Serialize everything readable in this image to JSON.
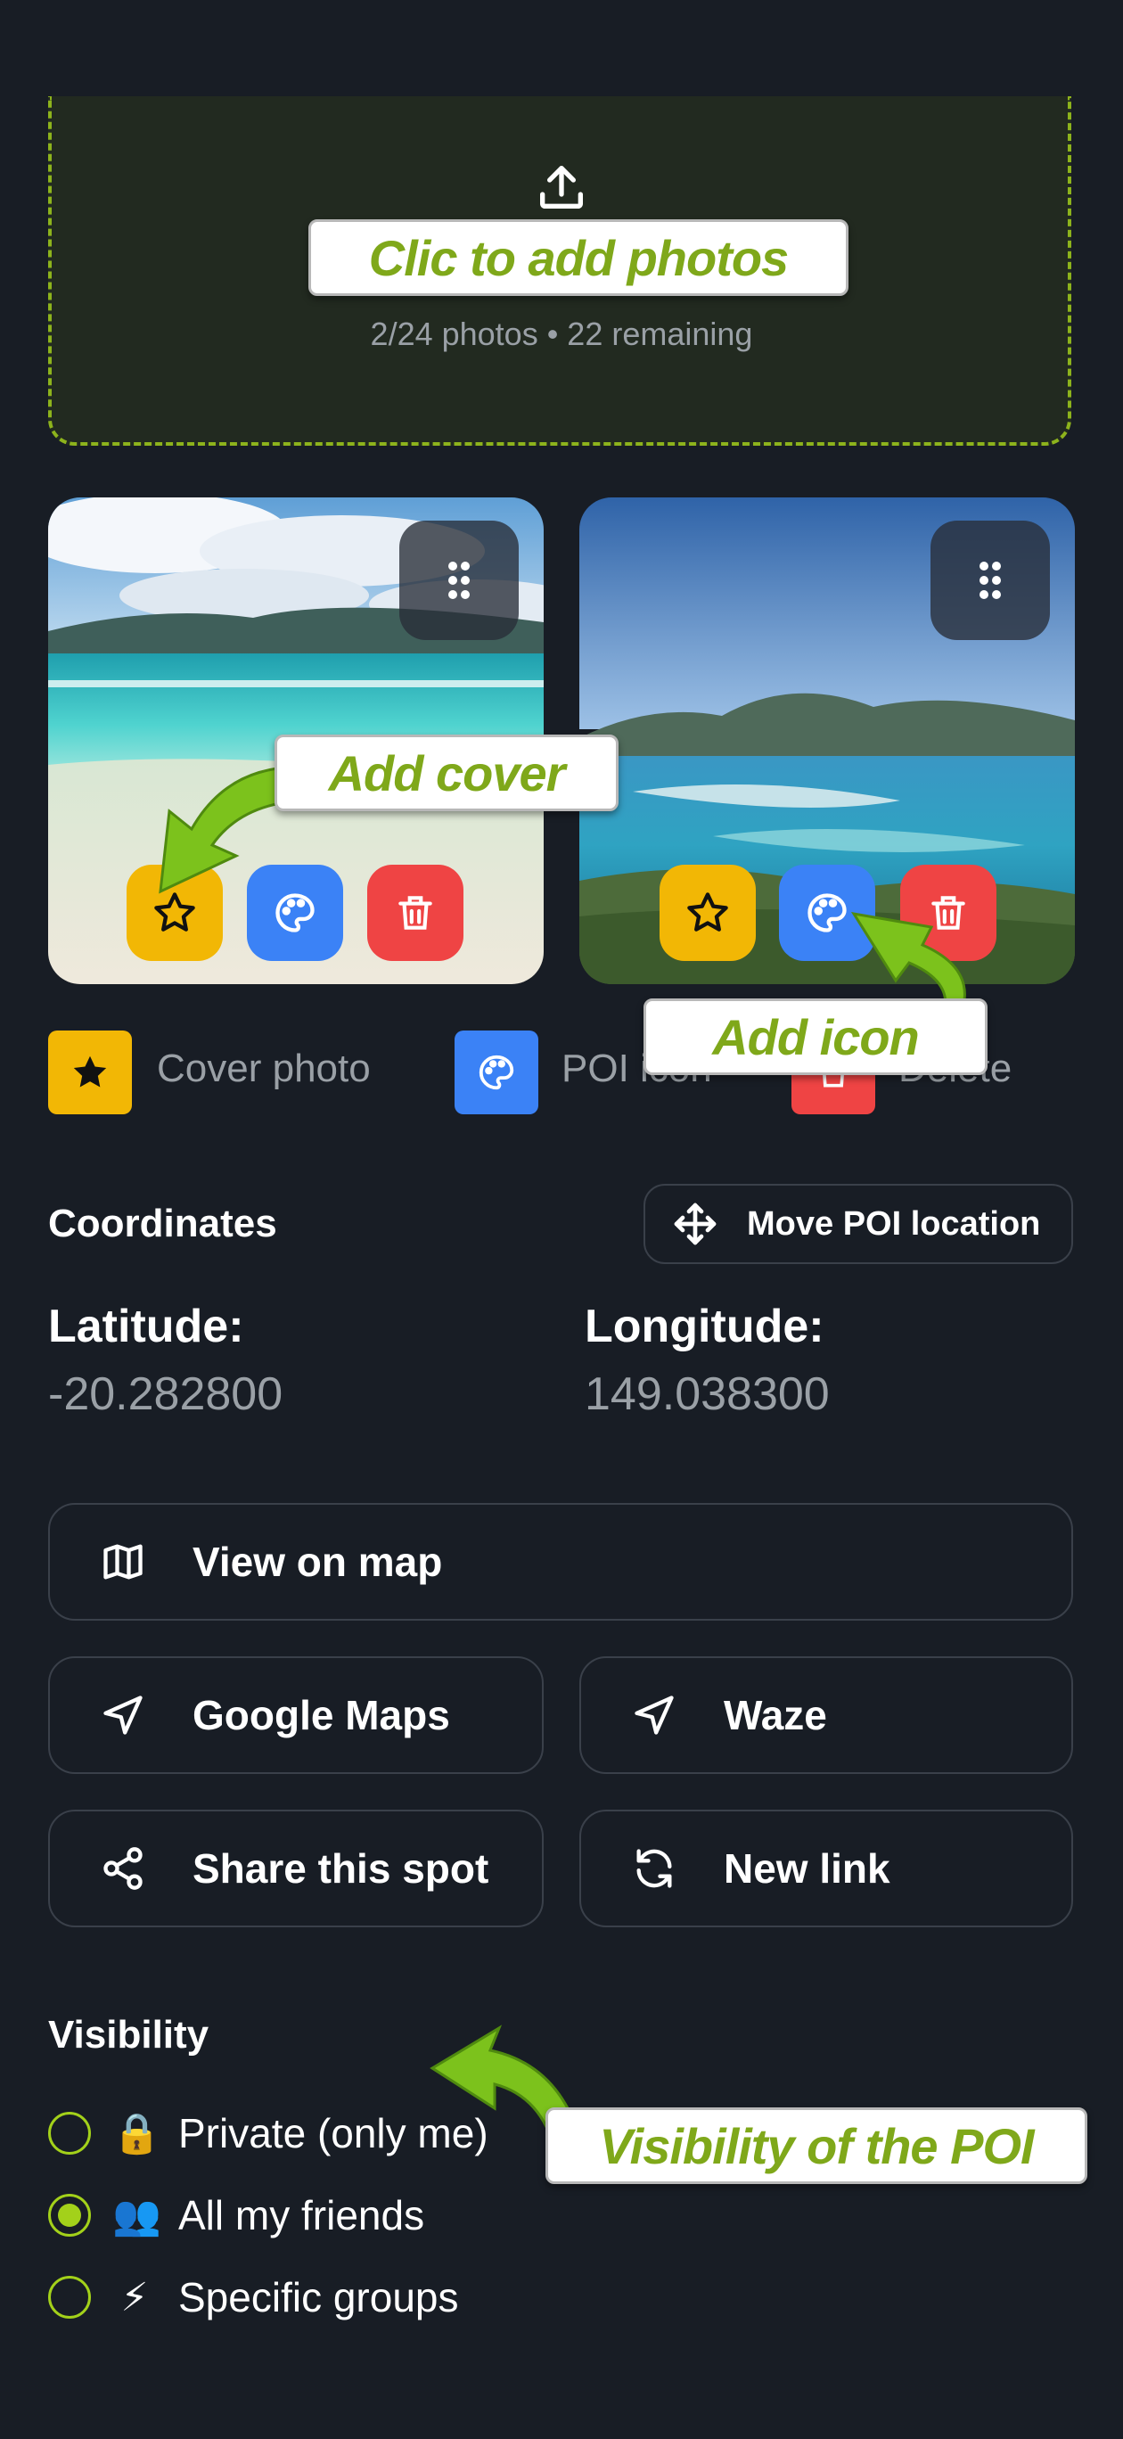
{
  "upload": {
    "callout": "Clic to add photos",
    "count_text": "2/24 photos • 22 remaining",
    "icon": "upload-icon"
  },
  "photos": [
    {
      "name": "beach-photo-1",
      "scene": "tropical-beach"
    },
    {
      "name": "beach-photo-2",
      "scene": "lagoon-view"
    }
  ],
  "callouts": {
    "add_cover": "Add cover",
    "add_icon": "Add icon",
    "visibility": "Visibility of the POI"
  },
  "legend": {
    "cover": "Cover photo",
    "poi_icon": "POI icon",
    "delete": "Delete"
  },
  "coordinates": {
    "title": "Coordinates",
    "move_button": "Move POI location",
    "latitude_label": "Latitude:",
    "latitude_value": "-20.282800",
    "longitude_label": "Longitude:",
    "longitude_value": "149.038300"
  },
  "actions": {
    "view_on_map": "View on map",
    "google_maps": "Google Maps",
    "waze": "Waze",
    "share": "Share this spot",
    "new_link": "New link"
  },
  "visibility": {
    "title": "Visibility",
    "options": [
      {
        "emoji": "🔒",
        "label": "Private (only me)",
        "selected": false
      },
      {
        "emoji": "👥",
        "label": "All my friends",
        "selected": true
      },
      {
        "emoji": "⚡",
        "label": "Specific groups",
        "selected": false
      }
    ]
  },
  "colors": {
    "background": "#181d25",
    "accent_green": "#a3d11a",
    "cover_yellow": "#f2b705",
    "icon_blue": "#3b82f6",
    "delete_red": "#ef4444"
  }
}
